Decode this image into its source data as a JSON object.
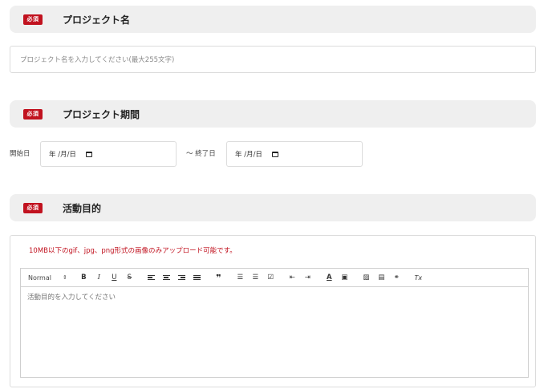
{
  "sections": [
    {
      "badge": "必須",
      "title": "プロジェクト名"
    },
    {
      "badge": "必須",
      "title": "プロジェクト期間"
    },
    {
      "badge": "必須",
      "title": "活動目的"
    }
  ],
  "project_name": {
    "placeholder": "プロジェクト名を入力してください(最大255文字)"
  },
  "period": {
    "start_label": "開始日",
    "start_value": "年 /月/日",
    "end_label": "〜 終了日",
    "end_value": "年 /月/日"
  },
  "purpose": {
    "notice": "10MB以下のgif、jpg、png形式の画像のみアップロード可能です。",
    "placeholder": "活動目的を入力してください",
    "toolbar": {
      "format": "Normal",
      "bold": "B",
      "italic": "I",
      "underline": "U",
      "strike": "S",
      "quote": "❞",
      "clean": "Tx"
    }
  }
}
